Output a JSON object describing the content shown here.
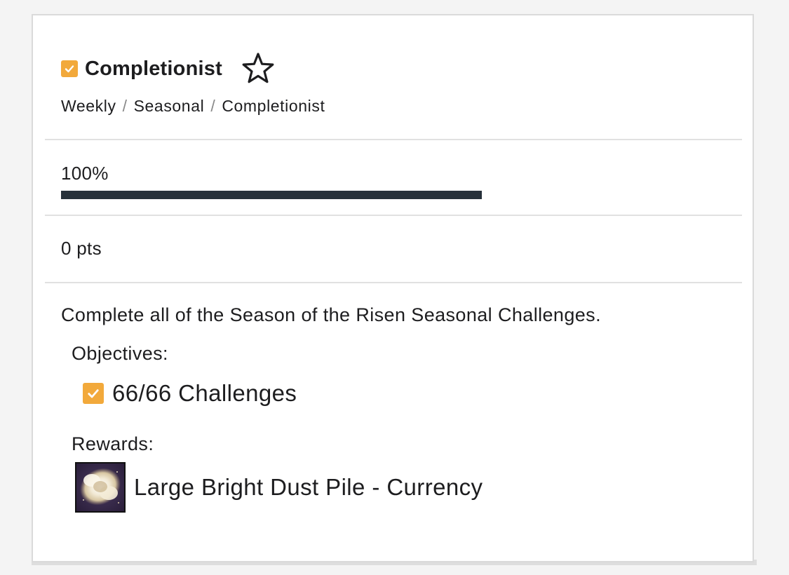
{
  "colors": {
    "accent_orange": "#f2a93b",
    "progress_fill": "#27313a",
    "card_border": "#dadada",
    "divider": "#e1e1e1"
  },
  "record": {
    "completed": true,
    "title": "Completionist",
    "star_icon": "star-outline-icon",
    "breadcrumb": [
      "Weekly",
      "Seasonal",
      "Completionist"
    ],
    "breadcrumb_separator": "/"
  },
  "progress": {
    "label": "100%",
    "fraction": 1.0
  },
  "score": {
    "label": "0 pts"
  },
  "details": {
    "description": "Complete all of the Season of the Risen Seasonal Challenges.",
    "objectives_label": "Objectives:",
    "objectives": [
      {
        "completed": true,
        "text": "66/66 Challenges"
      }
    ],
    "rewards_label": "Rewards:",
    "rewards": [
      {
        "icon": "bright-dust-icon",
        "text": "Large Bright Dust Pile - Currency"
      }
    ]
  }
}
